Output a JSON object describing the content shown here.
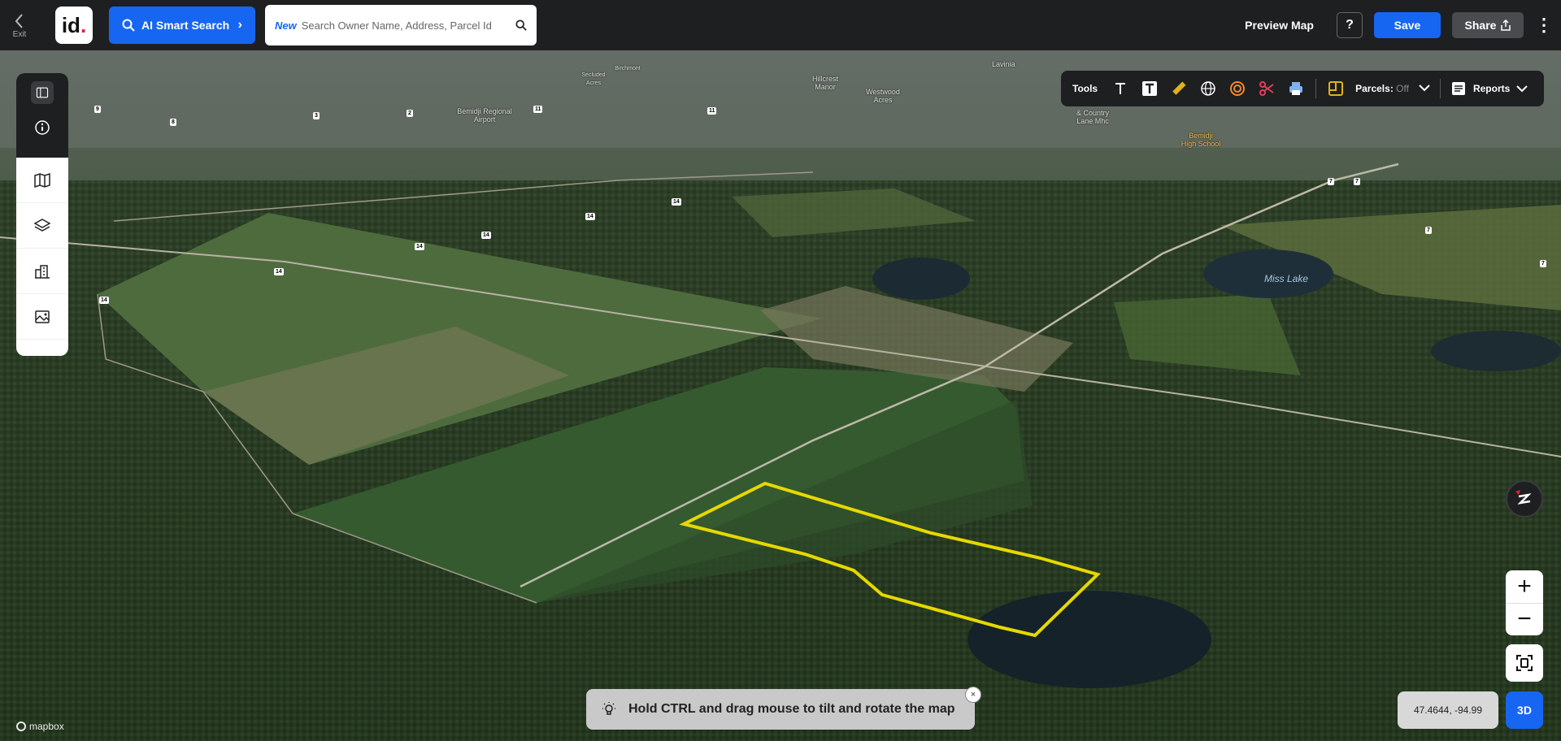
{
  "header": {
    "exit_label": "Exit",
    "logo_text": "id",
    "logo_dot": ".",
    "ai_search_label": "AI Smart Search",
    "search_new_badge": "New",
    "search_placeholder": "Search Owner Name, Address, Parcel Id",
    "preview_label": "Preview Map",
    "help_label": "?",
    "save_label": "Save",
    "share_label": "Share"
  },
  "tools": {
    "label": "Tools",
    "parcels_label": "Parcels:",
    "parcels_state": "Off",
    "reports_label": "Reports"
  },
  "map": {
    "place_labels": [
      "Lavinia",
      "Hillcrest Manor",
      "Westwood Acres",
      "Bemidji Regional Airport",
      "& Country Lane Mhc",
      "Bemidji High School",
      "Secluded Acres",
      "Birchmont"
    ],
    "lake_label": "Miss Lake",
    "road_shields": [
      "14",
      "14",
      "14",
      "14",
      "14",
      "14",
      "7",
      "7",
      "7",
      "7",
      "11",
      "11",
      "2",
      "3",
      "8",
      "9"
    ],
    "coordinates": "47.4644, -94.99",
    "view_mode": "3D",
    "attribution": "mapbox",
    "colors": {
      "parcel_outline": "#e6d800",
      "accent": "#1766f2"
    }
  },
  "hint": {
    "text": "Hold CTRL and drag mouse to tilt and rotate the map",
    "close_label": "×"
  },
  "icons": {
    "sidebar": [
      "collapse-panel-icon",
      "info-icon",
      "map-icon",
      "layers-icon",
      "buildings-icon",
      "image-icon"
    ],
    "tools": [
      "text-icon",
      "text-box-icon",
      "ruler-icon",
      "globe-icon",
      "radius-icon",
      "scissors-icon",
      "print-icon",
      "parcel-icon",
      "reports-icon"
    ]
  }
}
